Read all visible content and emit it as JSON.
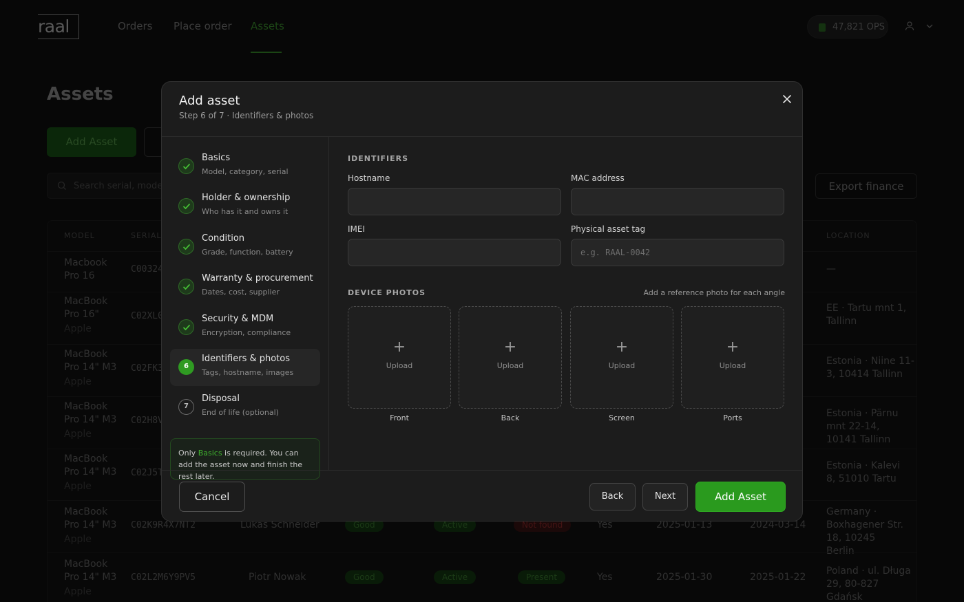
{
  "nav": {
    "logo": "raal",
    "links": [
      "Orders",
      "Place order",
      "Assets"
    ],
    "credits": "47,821 OPS"
  },
  "page": {
    "title": "Assets",
    "add_asset_label": "Add Asset",
    "search_placeholder": "Search serial, model...",
    "export_label": "Export finance"
  },
  "table": {
    "headers": [
      "MODEL",
      "SERIAL",
      "LOCATION"
    ],
    "rows": [
      {
        "model": "Macbook Pro 16",
        "brand": "",
        "serial": "C00324",
        "holder": "",
        "grade": "",
        "status": "",
        "mdm": "",
        "enc": "",
        "date1": "",
        "date2": "",
        "location": "—"
      },
      {
        "model": "MacBook Pro 16\"",
        "brand": "Apple",
        "serial": "C02XL0",
        "holder": "",
        "grade": "",
        "status": "",
        "mdm": "",
        "enc": "",
        "date1": "",
        "date2": "",
        "location": "EE · Tartu mnt 1, Tallinn"
      },
      {
        "model": "MacBook Pro 14\" M3",
        "brand": "Apple",
        "serial": "C02FK3",
        "holder": "",
        "grade": "",
        "status": "",
        "mdm": "",
        "enc": "",
        "date1": "",
        "date2": "",
        "location": "Estonia · Niine 11-3, 10414 Tallinn"
      },
      {
        "model": "MacBook Pro 14\" M3",
        "brand": "Apple",
        "serial": "C02H8V",
        "holder": "",
        "grade": "",
        "status": "",
        "mdm": "",
        "enc": "",
        "date1": "",
        "date2": "",
        "location": "Estonia · Pärnu mnt 22-14, 10141 Tallinn"
      },
      {
        "model": "MacBook Pro 14\" M3",
        "brand": "Apple",
        "serial": "C02J5T",
        "holder": "",
        "grade": "",
        "status": "",
        "mdm": "",
        "enc": "",
        "date1": "",
        "date2": "",
        "location": "Estonia · Kalevi 8, 51010 Tartu"
      },
      {
        "model": "MacBook Pro 14\" M3",
        "brand": "Apple",
        "serial": "C02K9R4X7NT2",
        "holder": "Lukas Schneider",
        "grade": "Good",
        "status": "Active",
        "mdm": "Not found",
        "enc": "Yes",
        "date1": "2025-01-13",
        "date2": "2024-03-14",
        "location": "Germany · Boxhagener Str. 18, 10245 Berlin"
      },
      {
        "model": "MacBook Pro 14\" M3",
        "brand": "Apple",
        "serial": "C02L2M6Y9PV5",
        "holder": "Piotr Nowak",
        "grade": "Good",
        "status": "Active",
        "mdm": "Present",
        "enc": "Yes",
        "date1": "2025-01-30",
        "date2": "2025-01-22",
        "location": "Poland · ul. Długa 29, 80-827 Gdańsk"
      }
    ]
  },
  "modal": {
    "title": "Add asset",
    "subtitle": "Step 6 of 7 · Identifiers & photos",
    "steps": [
      {
        "title": "Basics",
        "desc": "Model, category, serial",
        "state": "done"
      },
      {
        "title": "Holder & ownership",
        "desc": "Who has it and owns it",
        "state": "done"
      },
      {
        "title": "Condition",
        "desc": "Grade, function, battery",
        "state": "done"
      },
      {
        "title": "Warranty & procurement",
        "desc": "Dates, cost, supplier",
        "state": "done"
      },
      {
        "title": "Security & MDM",
        "desc": "Encryption, compliance",
        "state": "done"
      },
      {
        "title": "Identifiers & photos",
        "desc": "Tags, hostname, images",
        "state": "current",
        "num": "6"
      },
      {
        "title": "Disposal",
        "desc": "End of life (optional)",
        "state": "todo",
        "num": "7"
      }
    ],
    "hint": {
      "pre": "Only ",
      "highlight": "Basics",
      "post": " is required. You can add the asset now and finish the rest later."
    },
    "identifiers_label": "IDENTIFIERS",
    "fields": {
      "hostname": {
        "label": "Hostname",
        "value": "",
        "placeholder": ""
      },
      "mac": {
        "label": "MAC address",
        "value": "",
        "placeholder": ""
      },
      "imei": {
        "label": "IMEI",
        "value": "",
        "placeholder": ""
      },
      "asset_tag": {
        "label": "Physical asset tag",
        "value": "",
        "placeholder": "e.g. RAAL-0042"
      }
    },
    "photos_label": "DEVICE PHOTOS",
    "photos_hint": "Add a reference photo for each angle",
    "photos": [
      {
        "caption": "Front",
        "upload": "Upload"
      },
      {
        "caption": "Back",
        "upload": "Upload"
      },
      {
        "caption": "Screen",
        "upload": "Upload"
      },
      {
        "caption": "Ports",
        "upload": "Upload"
      }
    ],
    "buttons": {
      "cancel": "Cancel",
      "back": "Back",
      "next": "Next",
      "add": "Add Asset"
    }
  },
  "colors": {
    "accent": "#2a9a1e",
    "accent_text": "#3fb12e",
    "modal_bg": "#1c1c1c",
    "page_bg": "#0b0b0b"
  }
}
